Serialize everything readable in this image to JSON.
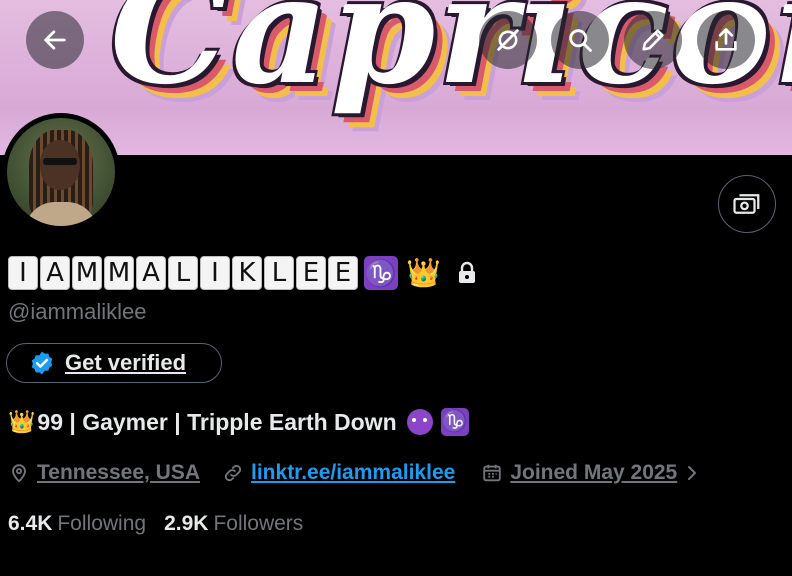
{
  "banner": {
    "word": "Capricorn"
  },
  "profile": {
    "display_name_letters": [
      "I",
      "A",
      "M",
      "M",
      "A",
      "L",
      "I",
      "K",
      "L",
      "E",
      "E"
    ],
    "zodiac_glyph": "♑",
    "crown_glyph": "👑",
    "handle": "@iammaliklee",
    "get_verified_label": "Get verified",
    "bio": {
      "crown": "👑",
      "text": "99 | Gaymer | Tripple Earth Down",
      "zodiac": "♑"
    },
    "location": "Tennessee, USA",
    "link": "linktr.ee/iammaliklee",
    "joined": "Joined May 2025",
    "following_count": "6.4K",
    "following_label": "Following",
    "followers_count": "2.9K",
    "followers_label": "Followers"
  },
  "colors": {
    "accent": "#1d9bf0",
    "zodiac_purple": "#7b3fbf",
    "muted": "#71767b"
  }
}
